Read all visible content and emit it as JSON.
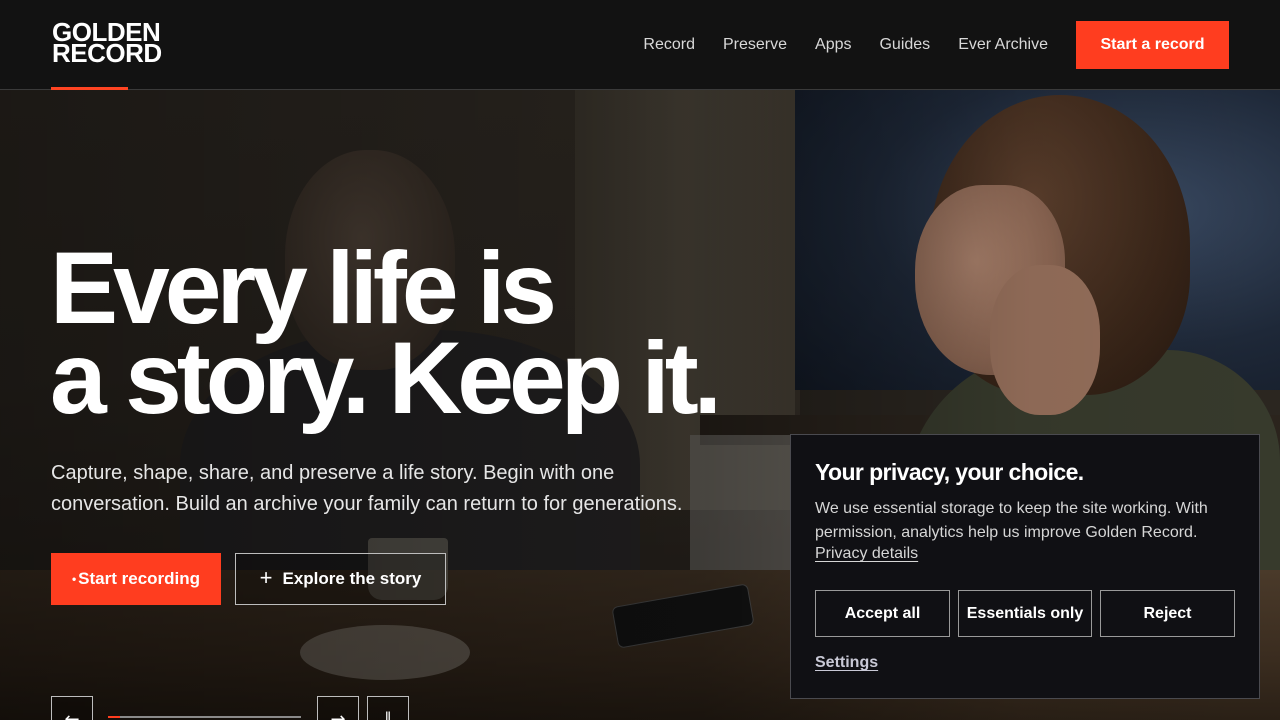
{
  "header": {
    "logo_line1": "GOLDEN",
    "logo_line2": "RECORD",
    "nav": [
      "Record",
      "Preserve",
      "Apps",
      "Guides",
      "Ever Archive"
    ],
    "cta_label": "Start a record"
  },
  "hero": {
    "headline_line1": "Every life is",
    "headline_line2": "a story. Keep it.",
    "sub_line1": "Capture, shape, share, and preserve a life story. Begin with one",
    "sub_line2": "conversation. Build an archive your family can return to for generations.",
    "primary_label": "Start recording",
    "secondary_label": "Explore the story",
    "controls": {
      "prev_icon": "arrow-left-icon",
      "next_icon": "arrow-right-icon",
      "pause_icon": "pause-icon",
      "progress_fraction": 0.06
    }
  },
  "consent": {
    "title": "Your privacy, your choice.",
    "body_line1": "We use essential storage to keep the site working. With",
    "body_line2": "permission, analytics help us improve Golden Record.",
    "privacy_link": "Privacy details",
    "accept_label": "Accept all",
    "essentials_label": "Essentials only",
    "reject_label": "Reject",
    "settings_label": "Settings"
  },
  "colors": {
    "accent": "#ff3d1f",
    "header_bg": "#121212",
    "dialog_bg": "#101014"
  }
}
